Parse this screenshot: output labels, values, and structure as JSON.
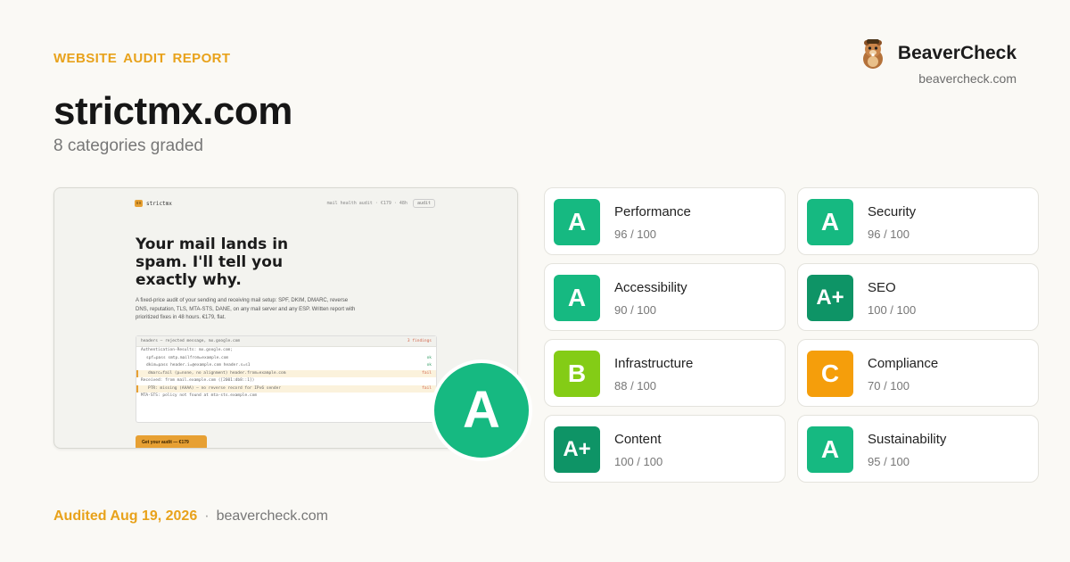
{
  "report": {
    "kicker": "WEBSITE  AUDIT  REPORT",
    "site": "strictmx.com",
    "subtitle": "8 categories graded",
    "overall_grade": "A",
    "overall_color": "#16b981"
  },
  "brand": {
    "name": "BeaverCheck",
    "url": "beavercheck.com",
    "logo_icon": "beaver-icon"
  },
  "screenshot": {
    "logo_mark": "sx",
    "logo_text": "strictmx",
    "nav_text": "mail health audit · €179 · 48h",
    "nav_button": "audit",
    "headline": "Your mail lands in spam. I'll tell you exactly why.",
    "paragraph": "A fixed-price audit of your sending and receiving mail setup: SPF, DKIM, DMARC, reverse DNS, reputation, TLS, MTA-STS, DANE, on any mail server and any ESP. Written report with prioritized fixes in 48 hours. €179, flat.",
    "code_header": "headers — rejected message, mx.google.com",
    "code_findings": "3 findings",
    "code_lines": [
      {
        "text": "Authentication-Results: mx.google.com;",
        "status": "",
        "style": ""
      },
      {
        "text": "spf=pass smtp.mailfrom=example.com",
        "status": "ok",
        "style": "ind"
      },
      {
        "text": "dkim=pass header.i=@example.com header.s=s1",
        "status": "ok",
        "style": "ind"
      },
      {
        "text": "dmarc=fail (p=none, no alignment) header.from=example.com",
        "status": "fail",
        "style": "ind warn"
      },
      {
        "text": "Received: from mail.example.com ([2001:db8::1])",
        "status": "",
        "style": ""
      },
      {
        "text": "PTR: missing (AAAA) — no reverse record for IPv6 sender",
        "status": "fail",
        "style": "ind warn"
      },
      {
        "text": "MTA-STS: policy not found at mta-sts.example.com",
        "status": "",
        "style": ""
      }
    ],
    "cta": "Get your audit — €179"
  },
  "categories": [
    {
      "label": "Performance",
      "score": "96 / 100",
      "grade": "A",
      "color": "#16b981"
    },
    {
      "label": "Security",
      "score": "96 / 100",
      "grade": "A",
      "color": "#16b981"
    },
    {
      "label": "Accessibility",
      "score": "90 / 100",
      "grade": "A",
      "color": "#16b981"
    },
    {
      "label": "SEO",
      "score": "100 / 100",
      "grade": "A+",
      "color": "#0e9466"
    },
    {
      "label": "Infrastructure",
      "score": "88 / 100",
      "grade": "B",
      "color": "#84cc16"
    },
    {
      "label": "Compliance",
      "score": "70 / 100",
      "grade": "C",
      "color": "#f59e0b"
    },
    {
      "label": "Content",
      "score": "100 / 100",
      "grade": "A+",
      "color": "#0e9466"
    },
    {
      "label": "Sustainability",
      "score": "95 / 100",
      "grade": "A",
      "color": "#16b981"
    }
  ],
  "footer": {
    "date": "Audited Aug 19, 2026",
    "separator": "·",
    "url": "beavercheck.com"
  }
}
